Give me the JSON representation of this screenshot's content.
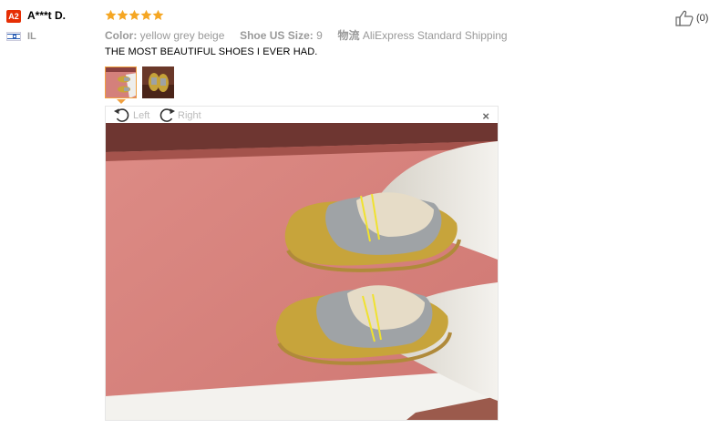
{
  "reviewer": {
    "avatar_label": "A2",
    "name": "A***t D.",
    "country": "IL",
    "flag_icon": "israel-flag-icon"
  },
  "rating": {
    "stars": 5,
    "max": 5,
    "color": "#f5a623"
  },
  "sku": {
    "color_label": "Color:",
    "color_value": "yellow grey beige",
    "size_label": "Shoe US Size:",
    "size_value": "9",
    "shipping_label": "物流",
    "shipping_value": "AliExpress Standard Shipping"
  },
  "feedback": {
    "text": "THE MOST BEAUTIFUL SHOES I EVER HAD."
  },
  "viewer": {
    "rotate_left_label": "Left",
    "rotate_right_label": "Right",
    "close_symbol": "×"
  },
  "likes": {
    "count": "(0)"
  },
  "colors": {
    "badge": "#e62e04",
    "accent": "#f0a040"
  }
}
